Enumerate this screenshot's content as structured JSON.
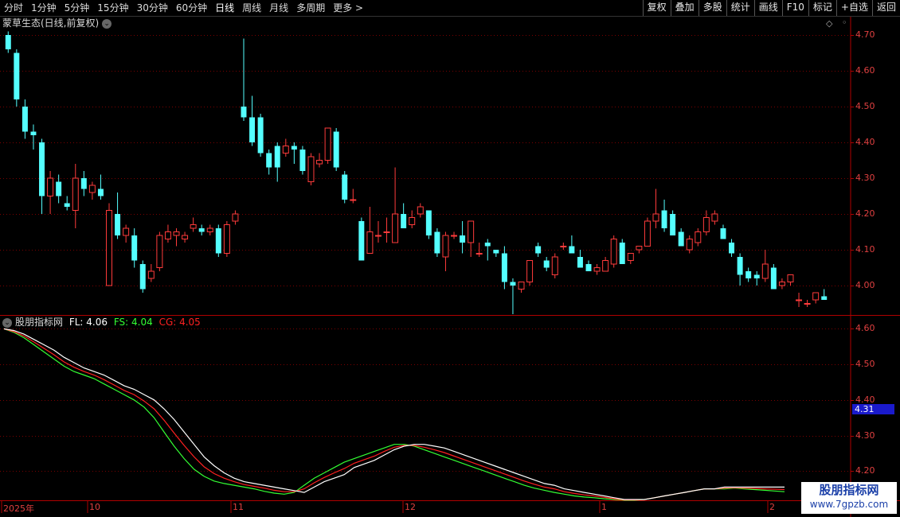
{
  "toolbar": {
    "periods": [
      "分时",
      "1分钟",
      "5分钟",
      "15分钟",
      "30分钟",
      "60分钟",
      "日线",
      "周线",
      "月线",
      "多周期",
      "更多 >"
    ],
    "active_period": "日线",
    "actions": [
      "复权",
      "叠加",
      "多股",
      "统计",
      "画线",
      "F10",
      "标记",
      "+自选",
      "返回"
    ]
  },
  "stock": {
    "title": "蒙草生态(日线,前复权)"
  },
  "indicator": {
    "name": "股朋指标网",
    "fl_label": "FL: 4.06",
    "fs_label": "FS: 4.04",
    "cg_label": "CG: 4.05",
    "last_value": "4.31"
  },
  "price_axis": [
    "4.70",
    "4.60",
    "4.50",
    "4.40",
    "4.30",
    "4.20",
    "4.10",
    "4.00"
  ],
  "indicator_axis": [
    "4.60",
    "4.50",
    "4.40",
    "4.30",
    "4.20"
  ],
  "dates": [
    "2025年",
    "10",
    "11",
    "12",
    "1",
    "2"
  ],
  "watermark": {
    "name": "股朋指标网",
    "url": "www.7gpzb.com"
  },
  "colors": {
    "up": "#ff3b3b",
    "down": "#54ffff",
    "fl": "#ffffff",
    "fs": "#33ff33",
    "cg": "#ff2020",
    "grid": "#7a0000"
  },
  "chart_data": {
    "type": "candlestick",
    "ylim": [
      3.92,
      4.72
    ],
    "candles": [
      {
        "o": 4.7,
        "h": 4.71,
        "l": 4.65,
        "c": 4.66
      },
      {
        "o": 4.65,
        "h": 4.66,
        "l": 4.5,
        "c": 4.52
      },
      {
        "o": 4.5,
        "h": 4.52,
        "l": 4.41,
        "c": 4.43
      },
      {
        "o": 4.43,
        "h": 4.45,
        "l": 4.38,
        "c": 4.42
      },
      {
        "o": 4.4,
        "h": 4.41,
        "l": 4.2,
        "c": 4.25
      },
      {
        "o": 4.25,
        "h": 4.32,
        "l": 4.2,
        "c": 4.3
      },
      {
        "o": 4.29,
        "h": 4.31,
        "l": 4.23,
        "c": 4.25
      },
      {
        "o": 4.23,
        "h": 4.25,
        "l": 4.21,
        "c": 4.22
      },
      {
        "o": 4.21,
        "h": 4.34,
        "l": 4.16,
        "c": 4.3
      },
      {
        "o": 4.3,
        "h": 4.32,
        "l": 4.25,
        "c": 4.27
      },
      {
        "o": 4.26,
        "h": 4.29,
        "l": 4.24,
        "c": 4.28
      },
      {
        "o": 4.27,
        "h": 4.31,
        "l": 4.24,
        "c": 4.25
      },
      {
        "o": 4.0,
        "h": 4.23,
        "l": 4.0,
        "c": 4.21
      },
      {
        "o": 4.2,
        "h": 4.26,
        "l": 4.13,
        "c": 4.14
      },
      {
        "o": 4.14,
        "h": 4.17,
        "l": 4.12,
        "c": 4.16
      },
      {
        "o": 4.14,
        "h": 4.16,
        "l": 4.05,
        "c": 4.07
      },
      {
        "o": 4.06,
        "h": 4.07,
        "l": 3.98,
        "c": 3.99
      },
      {
        "o": 4.02,
        "h": 4.06,
        "l": 4.01,
        "c": 4.04
      },
      {
        "o": 4.05,
        "h": 4.15,
        "l": 4.04,
        "c": 4.14
      },
      {
        "o": 4.13,
        "h": 4.17,
        "l": 4.12,
        "c": 4.15
      },
      {
        "o": 4.14,
        "h": 4.16,
        "l": 4.11,
        "c": 4.15
      },
      {
        "o": 4.13,
        "h": 4.15,
        "l": 4.12,
        "c": 4.14
      },
      {
        "o": 4.16,
        "h": 4.19,
        "l": 4.15,
        "c": 4.17
      },
      {
        "o": 4.16,
        "h": 4.17,
        "l": 4.14,
        "c": 4.15
      },
      {
        "o": 4.15,
        "h": 4.17,
        "l": 4.14,
        "c": 4.16
      },
      {
        "o": 4.16,
        "h": 4.17,
        "l": 4.08,
        "c": 4.09
      },
      {
        "o": 4.09,
        "h": 4.18,
        "l": 4.08,
        "c": 4.17
      },
      {
        "o": 4.18,
        "h": 4.21,
        "l": 4.17,
        "c": 4.2
      },
      {
        "o": 4.5,
        "h": 4.69,
        "l": 4.46,
        "c": 4.47
      },
      {
        "o": 4.47,
        "h": 4.53,
        "l": 4.39,
        "c": 4.4
      },
      {
        "o": 4.47,
        "h": 4.48,
        "l": 4.36,
        "c": 4.37
      },
      {
        "o": 4.37,
        "h": 4.38,
        "l": 4.31,
        "c": 4.33
      },
      {
        "o": 4.39,
        "h": 4.4,
        "l": 4.29,
        "c": 4.33
      },
      {
        "o": 4.37,
        "h": 4.41,
        "l": 4.36,
        "c": 4.39
      },
      {
        "o": 4.39,
        "h": 4.4,
        "l": 4.34,
        "c": 4.38
      },
      {
        "o": 4.38,
        "h": 4.39,
        "l": 4.31,
        "c": 4.32
      },
      {
        "o": 4.29,
        "h": 4.37,
        "l": 4.28,
        "c": 4.36
      },
      {
        "o": 4.34,
        "h": 4.37,
        "l": 4.33,
        "c": 4.35
      },
      {
        "o": 4.35,
        "h": 4.44,
        "l": 4.34,
        "c": 4.44
      },
      {
        "o": 4.43,
        "h": 4.44,
        "l": 4.32,
        "c": 4.33
      },
      {
        "o": 4.31,
        "h": 4.32,
        "l": 4.23,
        "c": 4.24
      },
      {
        "o": 4.24,
        "h": 4.27,
        "l": 4.23,
        "c": 4.24
      },
      {
        "o": 4.18,
        "h": 4.19,
        "l": 4.07,
        "c": 4.07
      },
      {
        "o": 4.09,
        "h": 4.22,
        "l": 4.09,
        "c": 4.15
      },
      {
        "o": 4.14,
        "h": 4.18,
        "l": 4.12,
        "c": 4.14
      },
      {
        "o": 4.15,
        "h": 4.19,
        "l": 4.12,
        "c": 4.15
      },
      {
        "o": 4.12,
        "h": 4.33,
        "l": 4.12,
        "c": 4.2
      },
      {
        "o": 4.2,
        "h": 4.23,
        "l": 4.16,
        "c": 4.16
      },
      {
        "o": 4.17,
        "h": 4.21,
        "l": 4.16,
        "c": 4.19
      },
      {
        "o": 4.2,
        "h": 4.23,
        "l": 4.19,
        "c": 4.22
      },
      {
        "o": 4.21,
        "h": 4.21,
        "l": 4.13,
        "c": 4.14
      },
      {
        "o": 4.15,
        "h": 4.16,
        "l": 4.08,
        "c": 4.09
      },
      {
        "o": 4.08,
        "h": 4.15,
        "l": 4.04,
        "c": 4.14
      },
      {
        "o": 4.14,
        "h": 4.15,
        "l": 4.13,
        "c": 4.14
      },
      {
        "o": 4.14,
        "h": 4.18,
        "l": 4.09,
        "c": 4.12
      },
      {
        "o": 4.12,
        "h": 4.18,
        "l": 4.08,
        "c": 4.18
      },
      {
        "o": 4.09,
        "h": 4.12,
        "l": 4.08,
        "c": 4.09
      },
      {
        "o": 4.12,
        "h": 4.13,
        "l": 4.07,
        "c": 4.11
      },
      {
        "o": 4.1,
        "h": 4.1,
        "l": 4.08,
        "c": 4.09
      },
      {
        "o": 4.09,
        "h": 4.11,
        "l": 3.99,
        "c": 4.01
      },
      {
        "o": 4.01,
        "h": 4.02,
        "l": 3.92,
        "c": 4.0
      },
      {
        "o": 3.99,
        "h": 4.01,
        "l": 3.98,
        "c": 4.01
      },
      {
        "o": 4.01,
        "h": 4.07,
        "l": 4.0,
        "c": 4.07
      },
      {
        "o": 4.11,
        "h": 4.12,
        "l": 4.08,
        "c": 4.09
      },
      {
        "o": 4.07,
        "h": 4.08,
        "l": 4.04,
        "c": 4.05
      },
      {
        "o": 4.03,
        "h": 4.09,
        "l": 4.02,
        "c": 4.08
      },
      {
        "o": 4.11,
        "h": 4.12,
        "l": 4.1,
        "c": 4.11
      },
      {
        "o": 4.11,
        "h": 4.14,
        "l": 4.09,
        "c": 4.09
      },
      {
        "o": 4.08,
        "h": 4.1,
        "l": 4.06,
        "c": 4.05
      },
      {
        "o": 4.06,
        "h": 4.07,
        "l": 4.04,
        "c": 4.04
      },
      {
        "o": 4.04,
        "h": 4.06,
        "l": 4.03,
        "c": 4.05
      },
      {
        "o": 4.04,
        "h": 4.08,
        "l": 4.04,
        "c": 4.07
      },
      {
        "o": 4.06,
        "h": 4.14,
        "l": 4.05,
        "c": 4.13
      },
      {
        "o": 4.12,
        "h": 4.13,
        "l": 4.06,
        "c": 4.06
      },
      {
        "o": 4.07,
        "h": 4.09,
        "l": 4.06,
        "c": 4.09
      },
      {
        "o": 4.1,
        "h": 4.11,
        "l": 4.09,
        "c": 4.11
      },
      {
        "o": 4.11,
        "h": 4.19,
        "l": 4.11,
        "c": 4.18
      },
      {
        "o": 4.18,
        "h": 4.27,
        "l": 4.16,
        "c": 4.2
      },
      {
        "o": 4.21,
        "h": 4.24,
        "l": 4.15,
        "c": 4.16
      },
      {
        "o": 4.2,
        "h": 4.21,
        "l": 4.14,
        "c": 4.14
      },
      {
        "o": 4.15,
        "h": 4.16,
        "l": 4.11,
        "c": 4.11
      },
      {
        "o": 4.1,
        "h": 4.14,
        "l": 4.09,
        "c": 4.13
      },
      {
        "o": 4.12,
        "h": 4.16,
        "l": 4.11,
        "c": 4.15
      },
      {
        "o": 4.15,
        "h": 4.21,
        "l": 4.14,
        "c": 4.19
      },
      {
        "o": 4.18,
        "h": 4.21,
        "l": 4.17,
        "c": 4.2
      },
      {
        "o": 4.16,
        "h": 4.17,
        "l": 4.13,
        "c": 4.13
      },
      {
        "o": 4.12,
        "h": 4.13,
        "l": 4.08,
        "c": 4.09
      },
      {
        "o": 4.08,
        "h": 4.09,
        "l": 4.0,
        "c": 4.03
      },
      {
        "o": 4.04,
        "h": 4.05,
        "l": 4.01,
        "c": 4.02
      },
      {
        "o": 4.03,
        "h": 4.04,
        "l": 4.0,
        "c": 4.02
      },
      {
        "o": 4.02,
        "h": 4.1,
        "l": 4.01,
        "c": 4.06
      },
      {
        "o": 4.05,
        "h": 4.06,
        "l": 3.99,
        "c": 3.99
      },
      {
        "o": 4.0,
        "h": 4.02,
        "l": 3.99,
        "c": 4.01
      },
      {
        "o": 4.01,
        "h": 4.03,
        "l": 4.0,
        "c": 4.03
      },
      {
        "o": 3.96,
        "h": 3.98,
        "l": 3.94,
        "c": 3.96
      },
      {
        "o": 3.95,
        "h": 3.96,
        "l": 3.94,
        "c": 3.95
      },
      {
        "o": 3.96,
        "h": 3.98,
        "l": 3.95,
        "c": 3.98
      },
      {
        "o": 3.97,
        "h": 3.99,
        "l": 3.96,
        "c": 3.96
      }
    ],
    "indicator": {
      "ylim": [
        4.12,
        4.63
      ],
      "fl": [
        4.6,
        4.595,
        4.585,
        4.57,
        4.555,
        4.54,
        4.52,
        4.505,
        4.49,
        4.48,
        4.47,
        4.455,
        4.44,
        4.43,
        4.415,
        4.4,
        4.375,
        4.345,
        4.31,
        4.275,
        4.24,
        4.215,
        4.195,
        4.18,
        4.17,
        4.165,
        4.16,
        4.155,
        4.15,
        4.145,
        4.14,
        4.155,
        4.17,
        4.18,
        4.19,
        4.21,
        4.22,
        4.23,
        4.245,
        4.26,
        4.27,
        4.275,
        4.275,
        4.27,
        4.265,
        4.255,
        4.245,
        4.235,
        4.225,
        4.215,
        4.205,
        4.195,
        4.185,
        4.175,
        4.165,
        4.16,
        4.15,
        4.145,
        4.14,
        4.135,
        4.13,
        4.125,
        4.12,
        4.12,
        4.12,
        4.125,
        4.13,
        4.135,
        4.14,
        4.145,
        4.15,
        4.15,
        4.155,
        4.155,
        4.155,
        4.155,
        4.155,
        4.155,
        4.155
      ],
      "fs": [
        4.6,
        4.59,
        4.575,
        4.555,
        4.535,
        4.515,
        4.495,
        4.48,
        4.47,
        4.46,
        4.445,
        4.43,
        4.415,
        4.4,
        4.38,
        4.35,
        4.31,
        4.27,
        4.235,
        4.205,
        4.185,
        4.172,
        4.165,
        4.16,
        4.155,
        4.15,
        4.143,
        4.138,
        4.135,
        4.14,
        4.16,
        4.18,
        4.195,
        4.21,
        4.225,
        4.235,
        4.245,
        4.255,
        4.265,
        4.275,
        4.275,
        4.27,
        4.26,
        4.25,
        4.24,
        4.23,
        4.22,
        4.21,
        4.2,
        4.19,
        4.18,
        4.17,
        4.16,
        4.152,
        4.146,
        4.14,
        4.135,
        4.13,
        4.127,
        4.125,
        4.122,
        4.12,
        4.118,
        4.118,
        4.12,
        4.125,
        4.13,
        4.135,
        4.14,
        4.145,
        4.15,
        4.15,
        4.15,
        4.152,
        4.15,
        4.148,
        4.146,
        4.144,
        4.142
      ],
      "cg": [
        4.6,
        4.592,
        4.58,
        4.563,
        4.545,
        4.527,
        4.507,
        4.492,
        4.48,
        4.47,
        4.457,
        4.442,
        4.427,
        4.415,
        4.397,
        4.375,
        4.343,
        4.307,
        4.272,
        4.24,
        4.212,
        4.193,
        4.18,
        4.17,
        4.162,
        4.157,
        4.152,
        4.146,
        4.142,
        4.142,
        4.15,
        4.167,
        4.182,
        4.195,
        4.207,
        4.222,
        4.232,
        4.242,
        4.255,
        4.267,
        4.272,
        4.272,
        4.267,
        4.26,
        4.252,
        4.242,
        4.232,
        4.222,
        4.212,
        4.202,
        4.192,
        4.182,
        4.172,
        4.163,
        4.155,
        4.15,
        4.142,
        4.137,
        4.133,
        4.13,
        4.126,
        4.122,
        4.119,
        4.119,
        4.12,
        4.125,
        4.13,
        4.135,
        4.14,
        4.145,
        4.15,
        4.15,
        4.152,
        4.153,
        4.152,
        4.151,
        4.15,
        4.149,
        4.148
      ]
    }
  }
}
